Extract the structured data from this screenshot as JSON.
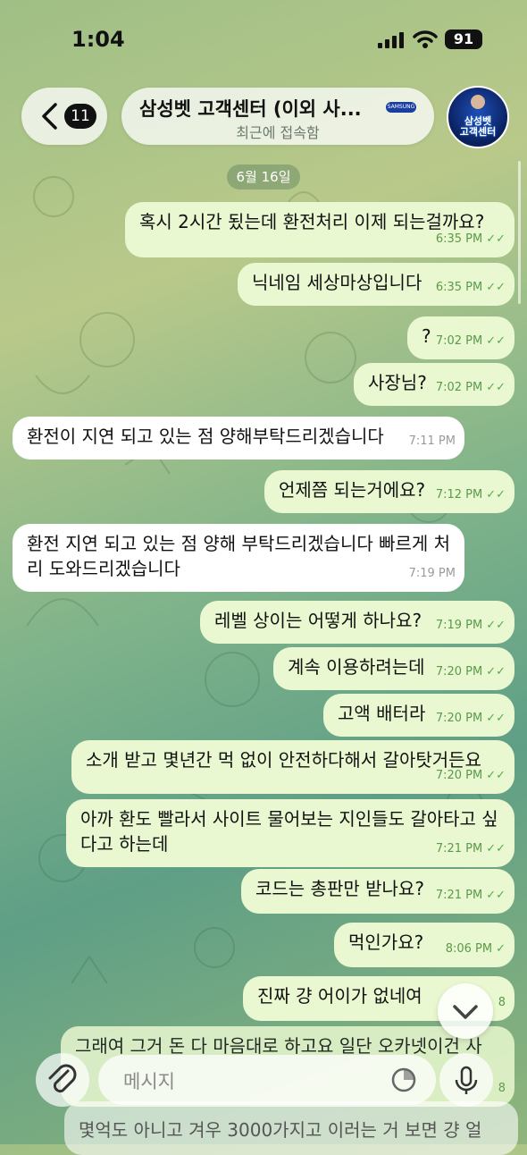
{
  "status_bar": {
    "time": "1:04",
    "battery": "91"
  },
  "header": {
    "back_badge": "11",
    "title": "삼성벳 고객센터 (이외 사...",
    "subtitle": "최근에 접속함",
    "title_logo_text": "SAMSUNG",
    "avatar_text_line1": "삼성벳",
    "avatar_text_line2": "고객센터"
  },
  "date_separator": "6월 16일",
  "messages": [
    {
      "dir": "out",
      "text": "혹시 2시간 됬는데 환전처리 이제 되는걸까요?",
      "time": "6:35 PM"
    },
    {
      "dir": "out",
      "text": "닉네임 세상마상입니다",
      "time": "6:35 PM"
    },
    {
      "dir": "out",
      "text": "?",
      "time": "7:02 PM"
    },
    {
      "dir": "out",
      "text": "사장님?",
      "time": "7:02 PM"
    },
    {
      "dir": "in",
      "text": "환전이 지연 되고 있는 점 양해부탁드리겠습니다",
      "time": "7:11 PM"
    },
    {
      "dir": "out",
      "text": "언제쯤 되는거에요?",
      "time": "7:12 PM"
    },
    {
      "dir": "in",
      "text": "환전 지연 되고 있는 점 양해 부탁드리겠습니다 빠르게 처리 도와드리겠습니다",
      "time": "7:19 PM"
    },
    {
      "dir": "out",
      "text": "레벨 상이는 어떻게 하나요?",
      "time": "7:19 PM"
    },
    {
      "dir": "out",
      "text": "계속 이용하려는데",
      "time": "7:20 PM"
    },
    {
      "dir": "out",
      "text": "고액 배터라",
      "time": "7:20 PM"
    },
    {
      "dir": "out",
      "text": "소개 받고 몇년간 먹 없이 안전하다해서 갈아탓거든요",
      "time": "7:20 PM"
    },
    {
      "dir": "out",
      "text": "아까 환도 빨라서 사이트 물어보는 지인들도 갈아타고 싶다고 하는데",
      "time": "7:21 PM"
    },
    {
      "dir": "out",
      "text": "코드는 총판만 받나요?",
      "time": "7:21 PM"
    },
    {
      "dir": "out",
      "text": "먹인가요?",
      "time": "8:06 PM"
    },
    {
      "dir": "out",
      "text": "진짜 걍 어이가 없네여",
      "time": "8"
    },
    {
      "dir": "out",
      "text": "그래여 그거 돈 다 마음대로 하고요 일단 오카넷이건 사",
      "time": "8"
    }
  ],
  "cut_message": "몇억도 아니고 겨우 3000가지고 이러는 거 보면 걍 얼",
  "input": {
    "placeholder": "메시지"
  },
  "colors": {
    "outgoing_bubble": "#e9f8d0",
    "incoming_bubble": "#ffffff",
    "tick_green": "#5aaa4a"
  }
}
